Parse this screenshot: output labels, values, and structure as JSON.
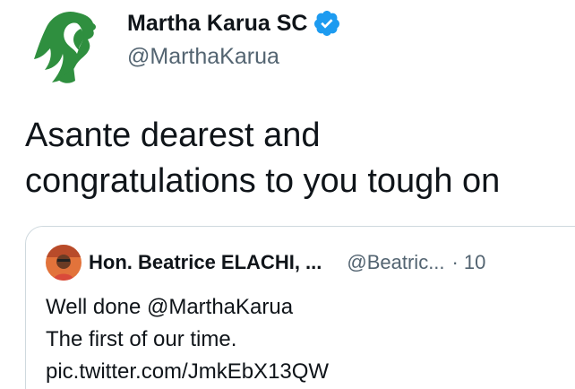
{
  "tweet": {
    "author": {
      "name": "Martha Karua SC",
      "handle": "@MarthaKarua",
      "avatar_icon": "woman-profile-silhouette-logo-icon",
      "verified_icon": "verified-badge-icon"
    },
    "text_lines": [
      "Asante dearest and",
      "congratulations to you tough on"
    ],
    "quoted": {
      "name": "Hon. Beatrice ELACHI, ...",
      "handle": "@Beatric...",
      "separator": "·",
      "time": "10",
      "avatar_icon": "user-avatar-photo-icon",
      "lines": [
        "Well done @MarthaKarua",
        "The first of our time.",
        "pic.twitter.com/JmkEbX13QW"
      ]
    }
  },
  "colors": {
    "text_primary": "#0f1419",
    "text_secondary": "#536471",
    "verified_blue": "#1d9bf0",
    "logo_green": "#2f8f3f",
    "border": "#cfd9de"
  }
}
